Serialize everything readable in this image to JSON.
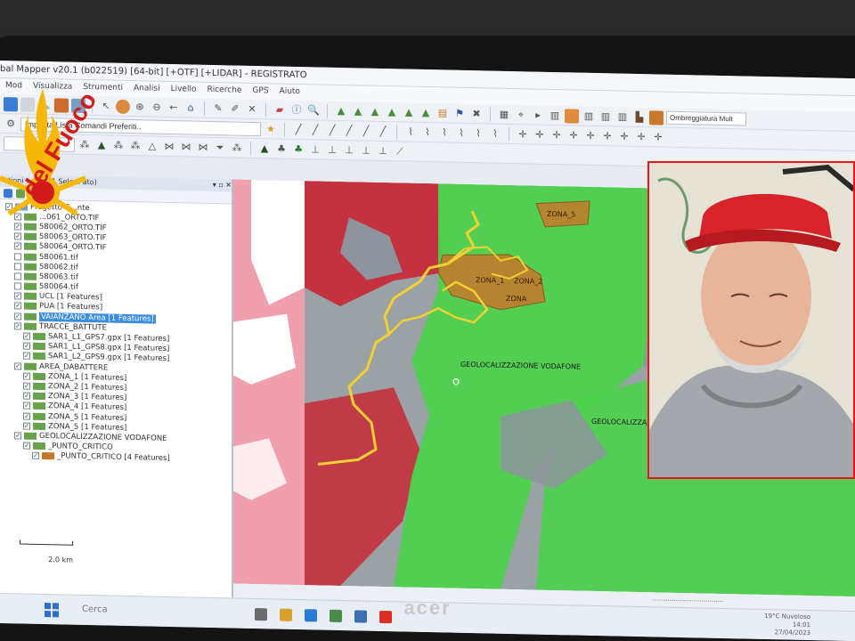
{
  "window": {
    "title": "bal Mapper v20.1 (b022519) [64-bit] [+OTF] [+LIDAR] - REGISTRATO"
  },
  "menu": [
    "Mod",
    "Visualizza",
    "Strumenti",
    "Analisi",
    "Livello",
    "Ricerche",
    "GPS",
    "Aiuto"
  ],
  "toolbar": {
    "command_input": "Imposta Lista Comandi Preferiti..",
    "projection_input": "Ombreggiatura Mult"
  },
  "layer_panel": {
    "title": "ationi ... erti, 1 Sele... ato)",
    "items": [
      {
        "label": "Progetto C...nte",
        "indent": 0,
        "checked": true
      },
      {
        "label": "...061_ORTO.TIF",
        "indent": 1,
        "checked": true
      },
      {
        "label": "580062_ORTO.TIF",
        "indent": 1,
        "checked": true
      },
      {
        "label": "580063_ORTO.TIF",
        "indent": 1,
        "checked": true
      },
      {
        "label": "580064_ORTO.TIF",
        "indent": 1,
        "checked": true
      },
      {
        "label": "580061.tif",
        "indent": 1,
        "checked": false
      },
      {
        "label": "580062.tif",
        "indent": 1,
        "checked": false
      },
      {
        "label": "580063.tif",
        "indent": 1,
        "checked": false
      },
      {
        "label": "580064.tif",
        "indent": 1,
        "checked": false
      },
      {
        "label": "UCL [1 Features]",
        "indent": 1,
        "checked": true
      },
      {
        "label": "PUA [1 Features]",
        "indent": 1,
        "checked": true
      },
      {
        "label": "VAIANZANO Area [1 Features]",
        "indent": 1,
        "checked": true,
        "selected": true
      },
      {
        "label": "TRACCE_BATTUTE",
        "indent": 1,
        "checked": true
      },
      {
        "label": "SAR1_L1_GPS7.gpx [1 Features]",
        "indent": 2,
        "checked": true
      },
      {
        "label": "SAR1_L1_GPS8.gpx [1 Features]",
        "indent": 2,
        "checked": true
      },
      {
        "label": "SAR1_L2_GPS9.gpx [1 Features]",
        "indent": 2,
        "checked": true
      },
      {
        "label": "AREA_DABATTERE",
        "indent": 1,
        "checked": true
      },
      {
        "label": "ZONA_1 [1 Features]",
        "indent": 2,
        "checked": true
      },
      {
        "label": "ZONA_2 [1 Features]",
        "indent": 2,
        "checked": true
      },
      {
        "label": "ZONA_3 [1 Features]",
        "indent": 2,
        "checked": true
      },
      {
        "label": "ZONA_4 [1 Features]",
        "indent": 2,
        "checked": true
      },
      {
        "label": "ZONA_5 [1 Features]",
        "indent": 2,
        "checked": true
      },
      {
        "label": "ZONA_5 [1 Features]",
        "indent": 2,
        "checked": true
      },
      {
        "label": "GEOLOCALIZZAZIONE VODAFONE",
        "indent": 1,
        "checked": true
      },
      {
        "label": "_PUNTO_CRITICO",
        "indent": 2,
        "checked": true
      },
      {
        "label": "_PUNTO_CRITICO [4 Features]",
        "indent": 3,
        "checked": true
      }
    ]
  },
  "map": {
    "labels": {
      "zona1": "ZONA_1",
      "zona2": "ZONA_2",
      "zona_b": "ZONA",
      "zona5": "ZONA_5",
      "geo1": "GEOLOCALIZZAZIONE VODAFONE",
      "geo2": "GEOLOCALIZZAZIONE VODAF"
    },
    "scale_label": "2.0 km"
  },
  "statusbar": {
    "text": "...................................."
  },
  "taskbar": {
    "search_placeholder": "Cerca",
    "weather": "19°C  Nuvoloso",
    "time": "14:01",
    "date": "27/04/2023"
  },
  "device": {
    "brand": "acer"
  },
  "logo": {
    "text": "del Fuoco"
  },
  "colors": {
    "red_zone": "#c4323f",
    "green_zone": "#4cd24c",
    "track": "#f2d033",
    "search_zone": "#c8782a",
    "inset_border": "#e8171e"
  }
}
